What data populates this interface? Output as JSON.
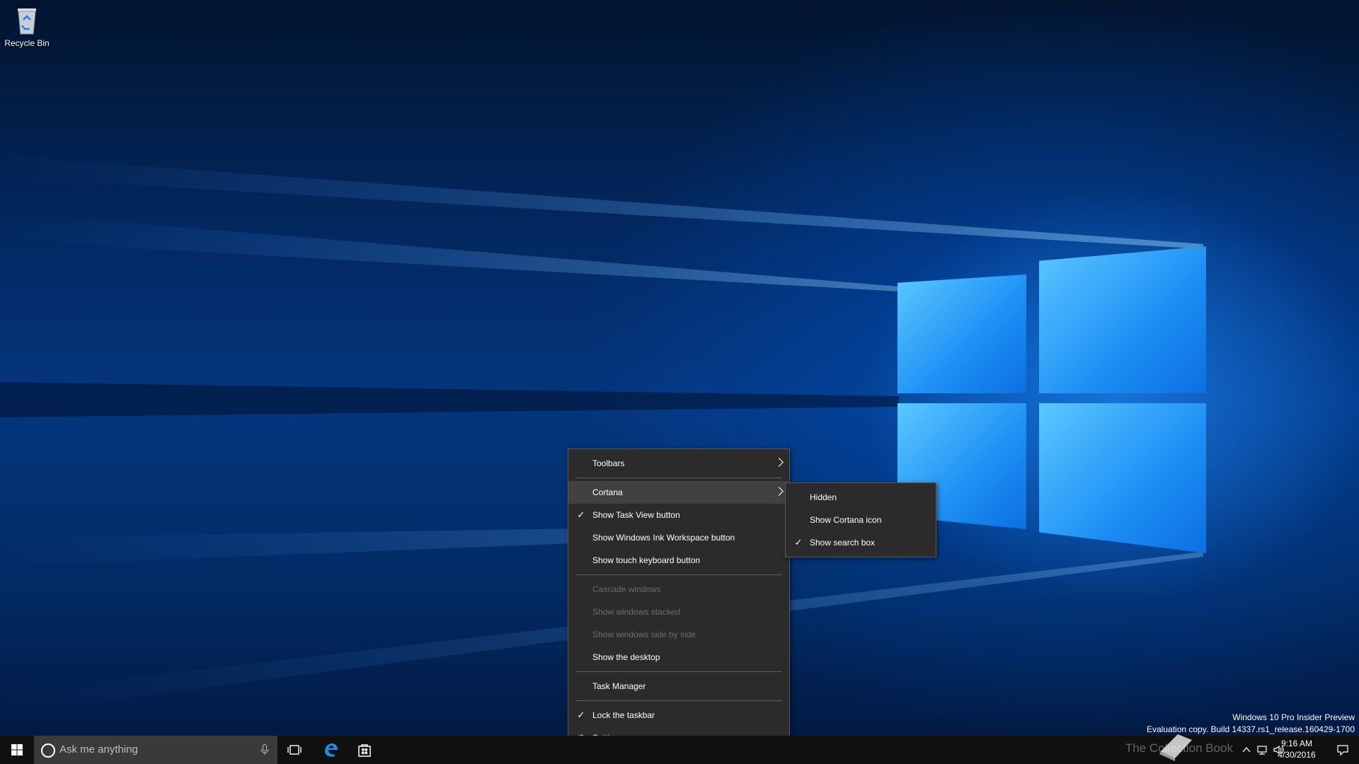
{
  "desktop": {
    "icons": [
      {
        "label": "Recycle Bin"
      }
    ]
  },
  "context_menu": {
    "items": [
      {
        "label": "Toolbars",
        "submenu": true
      },
      {
        "label": "Cortana",
        "submenu": true,
        "highlighted": true
      },
      {
        "label": "Show Task View button",
        "checked": true
      },
      {
        "label": "Show Windows Ink Workspace button"
      },
      {
        "label": "Show touch keyboard button"
      },
      {
        "label": "Cascade windows",
        "disabled": true
      },
      {
        "label": "Show windows stacked",
        "disabled": true
      },
      {
        "label": "Show windows side by side",
        "disabled": true
      },
      {
        "label": "Show the desktop"
      },
      {
        "label": "Task Manager"
      },
      {
        "label": "Lock the taskbar",
        "checked": true
      },
      {
        "label": "Settings",
        "icon": "gear-icon"
      }
    ],
    "check_glyph": "✓"
  },
  "cortana_submenu": {
    "items": [
      {
        "label": "Hidden"
      },
      {
        "label": "Show Cortana icon"
      },
      {
        "label": "Show search box",
        "checked": true
      }
    ]
  },
  "watermark": {
    "line1": "Windows 10 Pro Insider Preview",
    "line2": "Evaluation copy. Build 14337.rs1_release.160429-1700"
  },
  "taskbar": {
    "search_placeholder": "Ask me anything",
    "start_icon": "windows-logo-icon",
    "pinned": [
      "task-view-icon",
      "edge-icon",
      "store-icon"
    ],
    "overlay_text": "The Collection Book",
    "clock": {
      "time": "9:16 AM",
      "date": "4/30/2016"
    }
  },
  "colors": {
    "accent": "#0078d7",
    "menu_bg": "#2b2b2b",
    "menu_disabled": "#6d6d6d",
    "taskbar_bg": "#101010"
  }
}
